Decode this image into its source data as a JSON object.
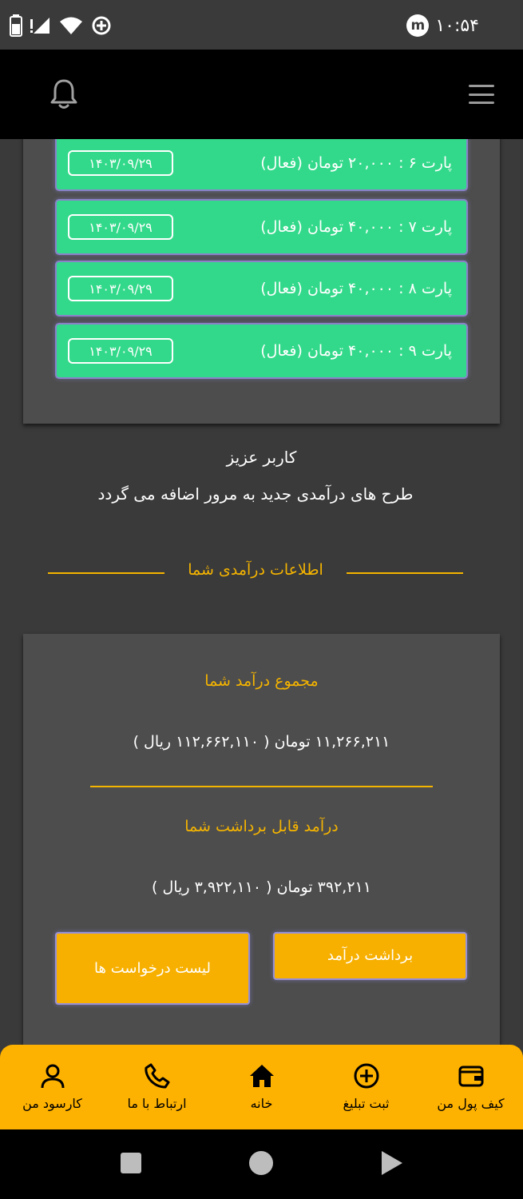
{
  "status_bar": {
    "time": "۱۰:۵۴",
    "app_badge": "m",
    "icons": [
      "battery-icon",
      "no-signal-icon",
      "wifi-icon",
      "data-saver-icon"
    ]
  },
  "header": {
    "menu_icon": "hamburger-icon",
    "notification_icon": "bell-icon"
  },
  "parts": [
    {
      "label": "پارت ۶ : ۲۰,۰۰۰ تومان (فعال)",
      "date": "۱۴۰۳/۰۹/۲۹"
    },
    {
      "label": "پارت ۷ : ۴۰,۰۰۰ تومان (فعال)",
      "date": "۱۴۰۳/۰۹/۲۹"
    },
    {
      "label": "پارت ۸ : ۴۰,۰۰۰ تومان (فعال)",
      "date": "۱۴۰۳/۰۹/۲۹"
    },
    {
      "label": "پارت ۹ : ۴۰,۰۰۰ تومان (فعال)",
      "date": "۱۴۰۳/۰۹/۲۹"
    }
  ],
  "notice": {
    "title": "کاربر عزیز",
    "text": "طرح های درآمدی جدید به مرور اضافه می گردد"
  },
  "income_section": {
    "heading": "اطلاعات درآمدی شما",
    "total_title": "مجموع درآمد شما",
    "total_value": "۱۱,۲۶۶,۲۱۱ تومان ( ۱۱۲,۶۶۲,۱۱۰ ریال )",
    "withdrawable_title": "درآمد قابل برداشت شما",
    "withdrawable_value": "۳۹۲,۲۱۱ تومان ( ۳,۹۲۲,۱۱۰ ریال )",
    "withdraw_button": "برداشت درآمد",
    "requests_button": "لیست درخواست ها"
  },
  "bottom_nav": [
    {
      "label": "کیف پول من",
      "icon": "wallet-icon"
    },
    {
      "label": "ثبت تبلیغ",
      "icon": "plus-circle-icon"
    },
    {
      "label": "خانه",
      "icon": "home-icon"
    },
    {
      "label": "ارتباط با ما",
      "icon": "phone-icon"
    },
    {
      "label": "کارسود من",
      "icon": "user-icon"
    }
  ],
  "colors": {
    "accent": "#f5b400",
    "part_green": "#33d98a",
    "card_bg": "#4d4d4d",
    "page_bg": "#3a3a3a"
  }
}
